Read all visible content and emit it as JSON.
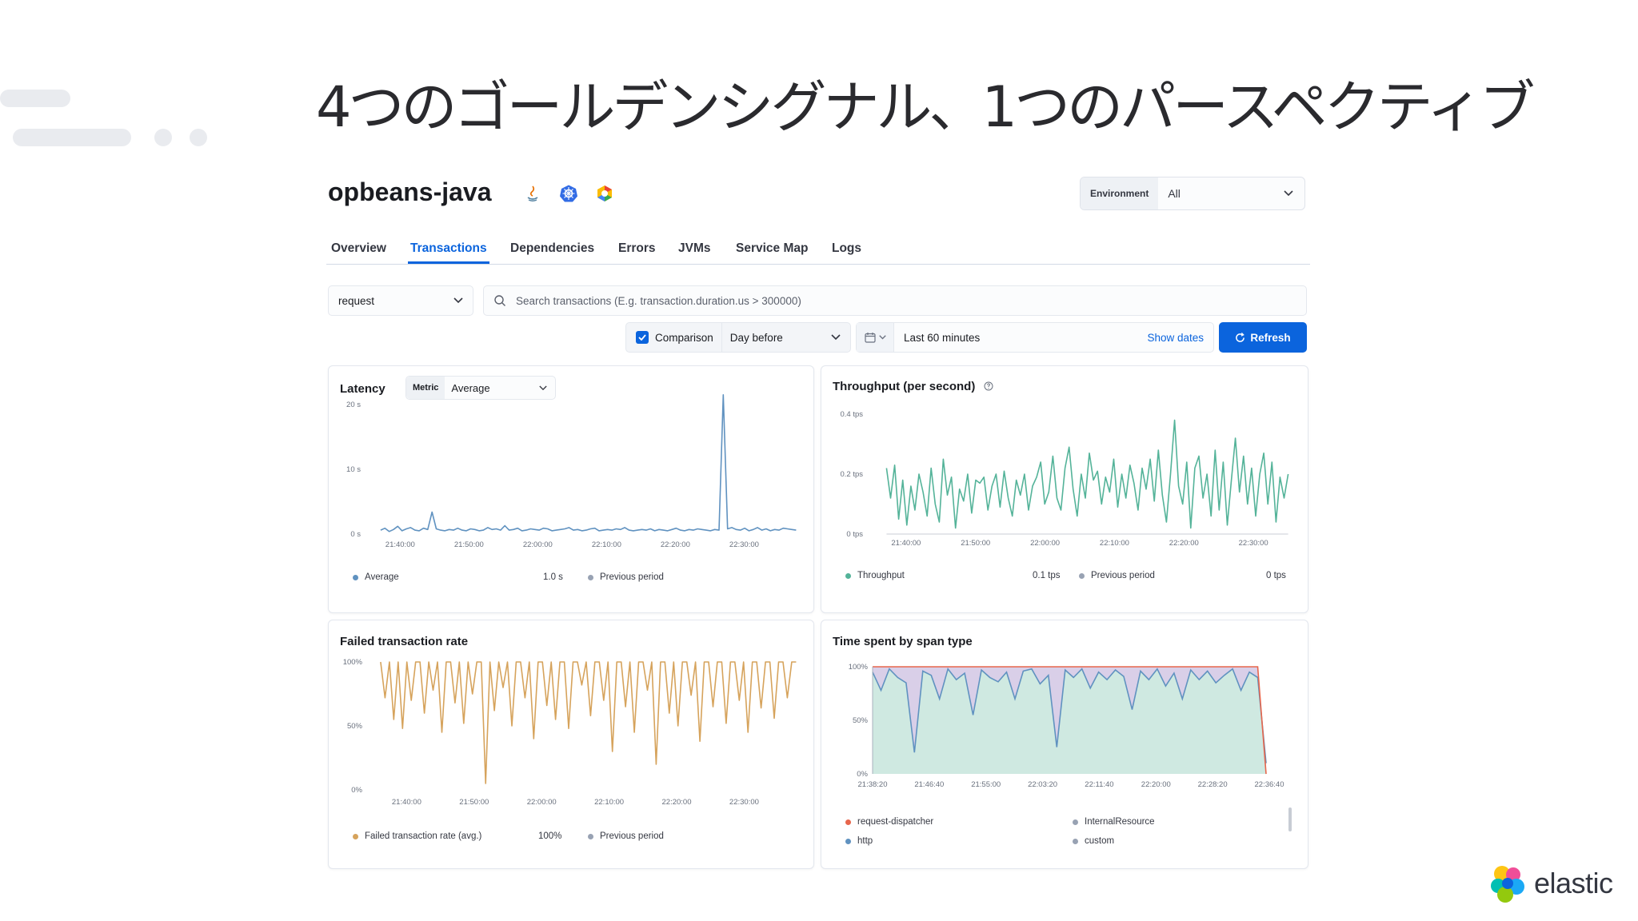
{
  "slide": {
    "title": "4つのゴールデンシグナル、1つのパースペクティブ"
  },
  "service": {
    "name": "opbeans-java",
    "icons": [
      "java-icon",
      "kubernetes-icon",
      "gcp-icon"
    ]
  },
  "environment": {
    "label": "Environment",
    "value": "All"
  },
  "tabs": [
    {
      "label": "Overview",
      "active": false
    },
    {
      "label": "Transactions",
      "active": true
    },
    {
      "label": "Dependencies",
      "active": false
    },
    {
      "label": "Errors",
      "active": false
    },
    {
      "label": "JVMs",
      "active": false
    },
    {
      "label": "Service Map",
      "active": false
    },
    {
      "label": "Logs",
      "active": false
    }
  ],
  "filters": {
    "transaction_type": "request",
    "search_placeholder": "Search transactions (E.g. transaction.duration.us > 300000)",
    "comparison_label": "Comparison",
    "comparison_checked": true,
    "comparison_value": "Day before",
    "time_range": "Last 60 minutes",
    "show_dates": "Show dates",
    "refresh": "Refresh"
  },
  "colors": {
    "accent": "#0b64dd",
    "latency": "#6092c0",
    "throughput": "#54b399",
    "failed": "#d6a35c",
    "previous": "#98a2b3"
  },
  "panels": {
    "latency": {
      "title": "Latency",
      "metric_label": "Metric",
      "metric_value": "Average",
      "legend": [
        {
          "label": "Average",
          "value": "1.0 s",
          "color": "#6092c0"
        },
        {
          "label": "Previous period",
          "value": "",
          "color": "#98a2b3"
        }
      ]
    },
    "throughput": {
      "title": "Throughput (per second)",
      "legend": [
        {
          "label": "Throughput",
          "value": "0.1 tps",
          "color": "#54b399"
        },
        {
          "label": "Previous period",
          "value": "0 tps",
          "color": "#98a2b3"
        }
      ]
    },
    "failed": {
      "title": "Failed transaction rate",
      "legend": [
        {
          "label": "Failed transaction rate (avg.)",
          "value": "100%",
          "color": "#d6a35c"
        },
        {
          "label": "Previous period",
          "value": "",
          "color": "#98a2b3"
        }
      ]
    },
    "spans": {
      "title": "Time spent by span type",
      "legend": [
        {
          "label": "request-dispatcher",
          "color": "#e7664c"
        },
        {
          "label": "InternalResource",
          "color": "#98a2b3"
        },
        {
          "label": "http",
          "color": "#6092c0"
        },
        {
          "label": "custom",
          "color": "#98a2b3"
        }
      ]
    }
  },
  "chart_data": [
    {
      "id": "latency",
      "type": "line",
      "title": "Latency",
      "x_ticks": [
        "21:40:00",
        "21:50:00",
        "22:00:00",
        "22:10:00",
        "22:20:00",
        "22:30:00"
      ],
      "y_ticks": [
        "0 s",
        "10 s",
        "20 s"
      ],
      "ylim": [
        0,
        20
      ],
      "series": [
        {
          "name": "Average",
          "values": [
            0.6,
            0.9,
            0.4,
            0.7,
            1.2,
            0.5,
            0.8,
            1.0,
            0.6,
            0.5,
            0.9,
            0.7,
            3.4,
            0.8,
            0.6,
            0.5,
            0.7,
            0.6,
            0.9,
            0.6,
            0.5,
            0.8,
            0.7,
            0.5,
            0.6,
            1.0,
            0.7,
            0.8,
            0.6,
            1.3,
            0.6,
            0.7,
            0.9,
            0.5,
            0.6,
            0.8,
            0.7,
            0.6,
            0.9,
            0.8,
            0.5,
            0.6,
            0.7,
            0.8,
            1.0,
            0.6,
            0.7,
            0.5,
            0.6,
            0.8,
            0.9,
            0.5,
            0.6,
            0.7,
            0.6,
            0.8,
            0.7,
            1.0,
            0.6,
            0.5,
            0.6,
            0.7,
            0.6,
            0.8,
            0.5,
            0.7,
            0.6,
            0.5,
            0.7,
            0.9,
            0.6,
            0.5,
            0.7,
            0.6,
            0.8,
            0.7,
            0.6,
            0.5,
            0.7,
            0.6,
            21.5,
            0.8,
            1.0,
            0.7,
            0.6,
            0.9,
            0.5,
            0.7,
            1.0,
            0.6,
            0.8,
            0.5,
            0.7,
            0.6,
            0.9,
            0.8,
            0.7,
            0.6
          ]
        }
      ]
    },
    {
      "id": "throughput",
      "type": "line",
      "title": "Throughput (per second)",
      "x_ticks": [
        "21:40:00",
        "21:50:00",
        "22:00:00",
        "22:10:00",
        "22:20:00",
        "22:30:00"
      ],
      "y_ticks": [
        "0 tps",
        "0.2 tps",
        "0.4 tps"
      ],
      "ylim": [
        0,
        0.4
      ],
      "series": [
        {
          "name": "Throughput",
          "values": [
            0.22,
            0.12,
            0.23,
            0.05,
            0.18,
            0.03,
            0.16,
            0.08,
            0.2,
            0.14,
            0.06,
            0.22,
            0.1,
            0.04,
            0.25,
            0.13,
            0.19,
            0.02,
            0.15,
            0.11,
            0.2,
            0.07,
            0.18,
            0.17,
            0.19,
            0.08,
            0.16,
            0.2,
            0.09,
            0.21,
            0.12,
            0.06,
            0.18,
            0.13,
            0.2,
            0.08,
            0.16,
            0.19,
            0.24,
            0.1,
            0.14,
            0.26,
            0.12,
            0.08,
            0.22,
            0.29,
            0.15,
            0.06,
            0.2,
            0.12,
            0.27,
            0.18,
            0.21,
            0.1,
            0.19,
            0.14,
            0.25,
            0.09,
            0.2,
            0.12,
            0.23,
            0.17,
            0.08,
            0.22,
            0.15,
            0.25,
            0.11,
            0.28,
            0.13,
            0.04,
            0.2,
            0.38,
            0.16,
            0.1,
            0.24,
            0.02,
            0.22,
            0.26,
            0.12,
            0.2,
            0.06,
            0.28,
            0.08,
            0.24,
            0.03,
            0.18,
            0.32,
            0.14,
            0.26,
            0.1,
            0.22,
            0.06,
            0.2,
            0.27,
            0.1,
            0.24,
            0.04,
            0.19,
            0.12,
            0.2
          ]
        }
      ]
    },
    {
      "id": "failed",
      "type": "line",
      "title": "Failed transaction rate",
      "x_ticks": [
        "21:40:00",
        "21:50:00",
        "22:00:00",
        "22:10:00",
        "22:20:00",
        "22:30:00"
      ],
      "y_ticks": [
        "0%",
        "50%",
        "100%"
      ],
      "ylim": [
        0,
        100
      ],
      "series": [
        {
          "name": "Failed transaction rate (avg.)",
          "values": [
            100,
            72,
            100,
            55,
            100,
            48,
            100,
            70,
            100,
            100,
            60,
            100,
            78,
            100,
            45,
            100,
            100,
            68,
            100,
            52,
            100,
            75,
            100,
            100,
            5,
            100,
            62,
            100,
            80,
            100,
            50,
            100,
            100,
            72,
            100,
            40,
            100,
            100,
            66,
            100,
            55,
            100,
            100,
            48,
            100,
            100,
            82,
            100,
            58,
            100,
            100,
            70,
            100,
            30,
            100,
            100,
            65,
            100,
            45,
            100,
            100,
            78,
            100,
            20,
            100,
            100,
            60,
            100,
            50,
            100,
            100,
            74,
            100,
            38,
            100,
            100,
            65,
            100,
            100,
            52,
            100,
            100,
            70,
            100,
            45,
            100,
            100,
            64,
            100,
            100,
            56,
            100,
            100,
            72,
            100,
            100
          ]
        }
      ]
    },
    {
      "id": "spans",
      "type": "area",
      "title": "Time spent by span type",
      "x_ticks": [
        "21:38:20",
        "21:46:40",
        "21:55:00",
        "22:03:20",
        "22:11:40",
        "22:20:00",
        "22:28:20",
        "22:36:40"
      ],
      "y_ticks": [
        "0%",
        "50%",
        "100%"
      ],
      "ylim": [
        0,
        100
      ],
      "series": [
        {
          "name": "http",
          "values": [
            95,
            78,
            98,
            90,
            85,
            20,
            96,
            92,
            70,
            98,
            88,
            94,
            55,
            97,
            90,
            86,
            95,
            70,
            96,
            98,
            84,
            92,
            25,
            97,
            90,
            98,
            80,
            95,
            88,
            97,
            91,
            60,
            96,
            88,
            98,
            82,
            94,
            70,
            97,
            88,
            96,
            85,
            92,
            98,
            78,
            95,
            90,
            10
          ]
        },
        {
          "name": "request-dispatcher",
          "values": [
            100,
            100,
            100,
            100,
            100,
            100,
            100,
            100,
            100,
            100,
            100,
            100,
            100,
            100,
            100,
            100,
            100,
            100,
            100,
            100,
            100,
            100,
            100,
            100,
            100,
            100,
            100,
            100,
            100,
            100,
            100,
            100,
            100,
            100,
            100,
            100,
            100,
            100,
            100,
            100,
            100,
            100,
            100,
            100,
            100,
            100,
            100,
            0
          ]
        }
      ]
    }
  ]
}
